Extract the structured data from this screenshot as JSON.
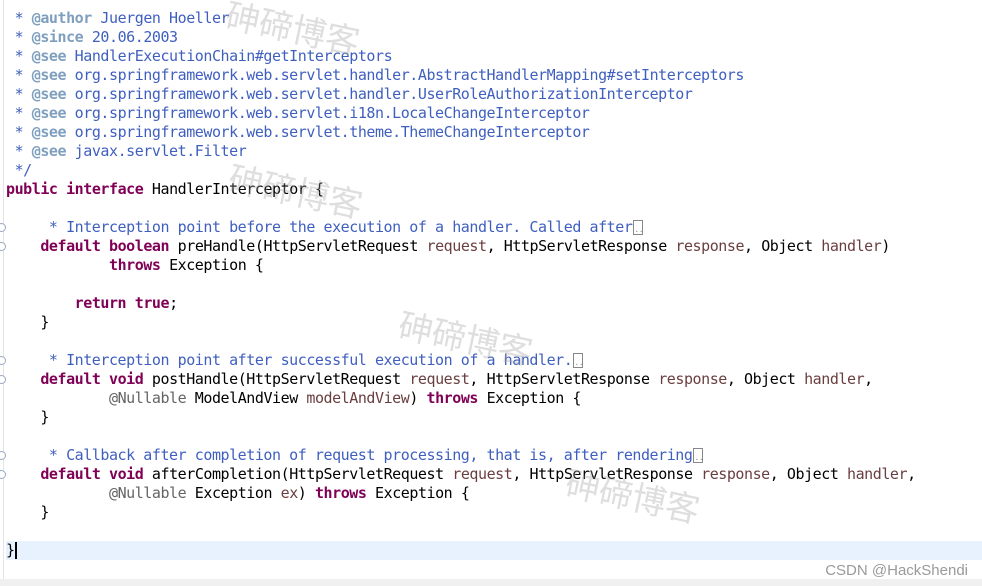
{
  "editor": {
    "current_line": 28,
    "fold_markers": [
      11,
      12,
      18,
      19,
      23,
      24
    ],
    "collapsed_after": [
      11,
      18,
      23
    ],
    "lines": [
      [
        [
          "cm",
          " * "
        ],
        [
          "tag",
          "@author"
        ],
        [
          "cm",
          " Juergen Hoeller"
        ]
      ],
      [
        [
          "cm",
          " * "
        ],
        [
          "tag",
          "@since"
        ],
        [
          "cm",
          " 20.06.2003"
        ]
      ],
      [
        [
          "cm",
          " * "
        ],
        [
          "tag",
          "@see"
        ],
        [
          "cm",
          " HandlerExecutionChain#getInterceptors"
        ]
      ],
      [
        [
          "cm",
          " * "
        ],
        [
          "tag",
          "@see"
        ],
        [
          "cm",
          " org.springframework.web.servlet.handler.AbstractHandlerMapping#setInterceptors"
        ]
      ],
      [
        [
          "cm",
          " * "
        ],
        [
          "tag",
          "@see"
        ],
        [
          "cm",
          " org.springframework.web.servlet.handler.UserRoleAuthorizationInterceptor"
        ]
      ],
      [
        [
          "cm",
          " * "
        ],
        [
          "tag",
          "@see"
        ],
        [
          "cm",
          " org.springframework.web.servlet.i18n.LocaleChangeInterceptor"
        ]
      ],
      [
        [
          "cm",
          " * "
        ],
        [
          "tag",
          "@see"
        ],
        [
          "cm",
          " org.springframework.web.servlet.theme.ThemeChangeInterceptor"
        ]
      ],
      [
        [
          "cm",
          " * "
        ],
        [
          "tag",
          "@see"
        ],
        [
          "cm",
          " javax.servlet.Filter"
        ]
      ],
      [
        [
          "cm",
          " */"
        ]
      ],
      [
        [
          "kw",
          "public"
        ],
        [
          "tx",
          " "
        ],
        [
          "kw",
          "interface"
        ],
        [
          "tx",
          " HandlerInterceptor {"
        ]
      ],
      [],
      [
        [
          "cm",
          "     * Interception point before the execution of a handler. Called after"
        ]
      ],
      [
        [
          "tx",
          "    "
        ],
        [
          "kw",
          "default"
        ],
        [
          "tx",
          " "
        ],
        [
          "kw",
          "boolean"
        ],
        [
          "tx",
          " preHandle(HttpServletRequest "
        ],
        [
          "pa",
          "request"
        ],
        [
          "tx",
          ", HttpServletResponse "
        ],
        [
          "pa",
          "response"
        ],
        [
          "tx",
          ", Object "
        ],
        [
          "pa",
          "handler"
        ],
        [
          "tx",
          ")"
        ]
      ],
      [
        [
          "tx",
          "            "
        ],
        [
          "kw",
          "throws"
        ],
        [
          "tx",
          " Exception {"
        ]
      ],
      [],
      [
        [
          "tx",
          "        "
        ],
        [
          "kw",
          "return"
        ],
        [
          "tx",
          " "
        ],
        [
          "kw",
          "true"
        ],
        [
          "tx",
          ";"
        ]
      ],
      [
        [
          "tx",
          "    }"
        ]
      ],
      [],
      [
        [
          "cm",
          "     * Interception point after successful execution of a handler."
        ]
      ],
      [
        [
          "tx",
          "    "
        ],
        [
          "kw",
          "default"
        ],
        [
          "tx",
          " "
        ],
        [
          "kw",
          "void"
        ],
        [
          "tx",
          " postHandle(HttpServletRequest "
        ],
        [
          "pa",
          "request"
        ],
        [
          "tx",
          ", HttpServletResponse "
        ],
        [
          "pa",
          "response"
        ],
        [
          "tx",
          ", Object "
        ],
        [
          "pa",
          "handler"
        ],
        [
          "tx",
          ","
        ]
      ],
      [
        [
          "tx",
          "            "
        ],
        [
          "an",
          "@Nullable"
        ],
        [
          "tx",
          " ModelAndView "
        ],
        [
          "pa",
          "modelAndView"
        ],
        [
          "tx",
          ") "
        ],
        [
          "kw",
          "throws"
        ],
        [
          "tx",
          " Exception {"
        ]
      ],
      [
        [
          "tx",
          "    }"
        ]
      ],
      [],
      [
        [
          "cm",
          "     * Callback after completion of request processing, that is, after rendering"
        ]
      ],
      [
        [
          "tx",
          "    "
        ],
        [
          "kw",
          "default"
        ],
        [
          "tx",
          " "
        ],
        [
          "kw",
          "void"
        ],
        [
          "tx",
          " afterCompletion(HttpServletRequest "
        ],
        [
          "pa",
          "request"
        ],
        [
          "tx",
          ", HttpServletResponse "
        ],
        [
          "pa",
          "response"
        ],
        [
          "tx",
          ", Object "
        ],
        [
          "pa",
          "handler"
        ],
        [
          "tx",
          ","
        ]
      ],
      [
        [
          "tx",
          "            "
        ],
        [
          "an",
          "@Nullable"
        ],
        [
          "tx",
          " Exception "
        ],
        [
          "pa",
          "ex"
        ],
        [
          "tx",
          ") "
        ],
        [
          "kw",
          "throws"
        ],
        [
          "tx",
          " Exception {"
        ]
      ],
      [
        [
          "tx",
          "    }"
        ]
      ],
      [],
      [
        [
          "tx",
          "}"
        ]
      ]
    ]
  },
  "watermark": "砷碲博客",
  "credit": "CSDN @HackShendi",
  "colors": {
    "keyword": "#7f0055",
    "comment": "#3f5fbf",
    "javadoc_tag": "#7f9fbf",
    "parameter": "#6a3e3e",
    "annotation": "#646464",
    "current_line": "#e8f2fe"
  }
}
